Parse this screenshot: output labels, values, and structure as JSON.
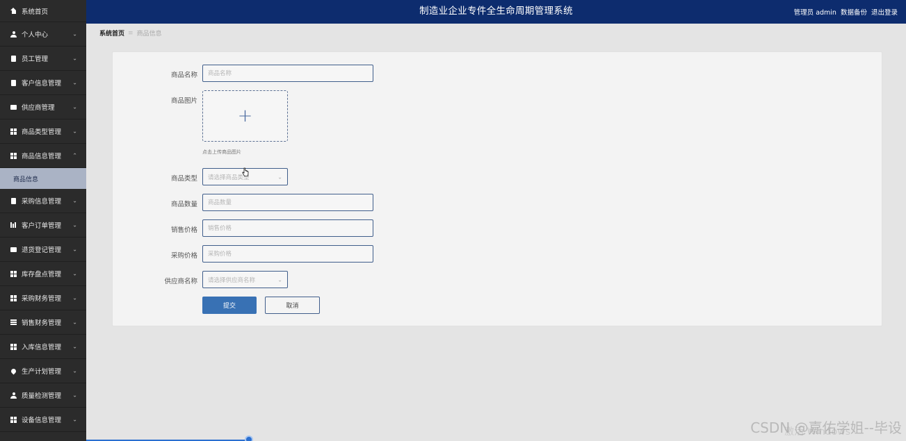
{
  "sidebar": {
    "items": [
      {
        "label": "系统首页",
        "icon": "home-icon",
        "chevron": false
      },
      {
        "label": "个人中心",
        "icon": "person-icon",
        "chevron": true
      },
      {
        "label": "员工管理",
        "icon": "clipboard-icon",
        "chevron": true
      },
      {
        "label": "客户信息管理",
        "icon": "clipboard-icon",
        "chevron": true
      },
      {
        "label": "供应商管理",
        "icon": "comment-icon",
        "chevron": true
      },
      {
        "label": "商品类型管理",
        "icon": "grid-icon",
        "chevron": true
      },
      {
        "label": "商品信息管理",
        "icon": "grid-icon",
        "chevron": true,
        "expanded": true
      }
    ],
    "active_sub": "商品信息",
    "items_after": [
      {
        "label": "采购信息管理",
        "icon": "clipboard-icon"
      },
      {
        "label": "客户订单管理",
        "icon": "bar-chart-icon"
      },
      {
        "label": "退货登记管理",
        "icon": "ticket-icon"
      },
      {
        "label": "库存盘点管理",
        "icon": "grid-icon"
      },
      {
        "label": "采购财务管理",
        "icon": "grid-icon"
      },
      {
        "label": "销售财务管理",
        "icon": "list-icon"
      },
      {
        "label": "入库信息管理",
        "icon": "grid-icon"
      },
      {
        "label": "生产计划管理",
        "icon": "map-pin-icon"
      },
      {
        "label": "质量检测管理",
        "icon": "person-icon"
      },
      {
        "label": "设备信息管理",
        "icon": "grid-icon"
      }
    ]
  },
  "header": {
    "title": "制造业企业专件全生命周期管理系统",
    "user": "管理员 admin",
    "backup": "数据备份",
    "logout": "退出登录"
  },
  "breadcrumb": {
    "home": "系统首页",
    "sep": "≡",
    "current": "商品信息"
  },
  "form": {
    "name": {
      "label": "商品名称",
      "placeholder": "商品名称"
    },
    "image": {
      "label": "商品图片",
      "tip": "点击上传商品图片"
    },
    "type": {
      "label": "商品类型",
      "placeholder": "请选择商品类型"
    },
    "quantity": {
      "label": "商品数量",
      "placeholder": "商品数量"
    },
    "sale_price": {
      "label": "销售价格",
      "placeholder": "销售价格"
    },
    "purchase_price": {
      "label": "采购价格",
      "placeholder": "采购价格"
    },
    "supplier": {
      "label": "供应商名称",
      "placeholder": "请选择供应商名称"
    },
    "submit": "提交",
    "cancel": "取消"
  },
  "colors": {
    "header_bg": "#0d2c6e",
    "sidebar_bg": "#2b2b2b",
    "active_sub_bg": "#aab3c5",
    "primary_button": "#3871b4"
  },
  "watermark": "CSDN @嘉佑学姐--毕设",
  "activate_text": "激活 Windows"
}
